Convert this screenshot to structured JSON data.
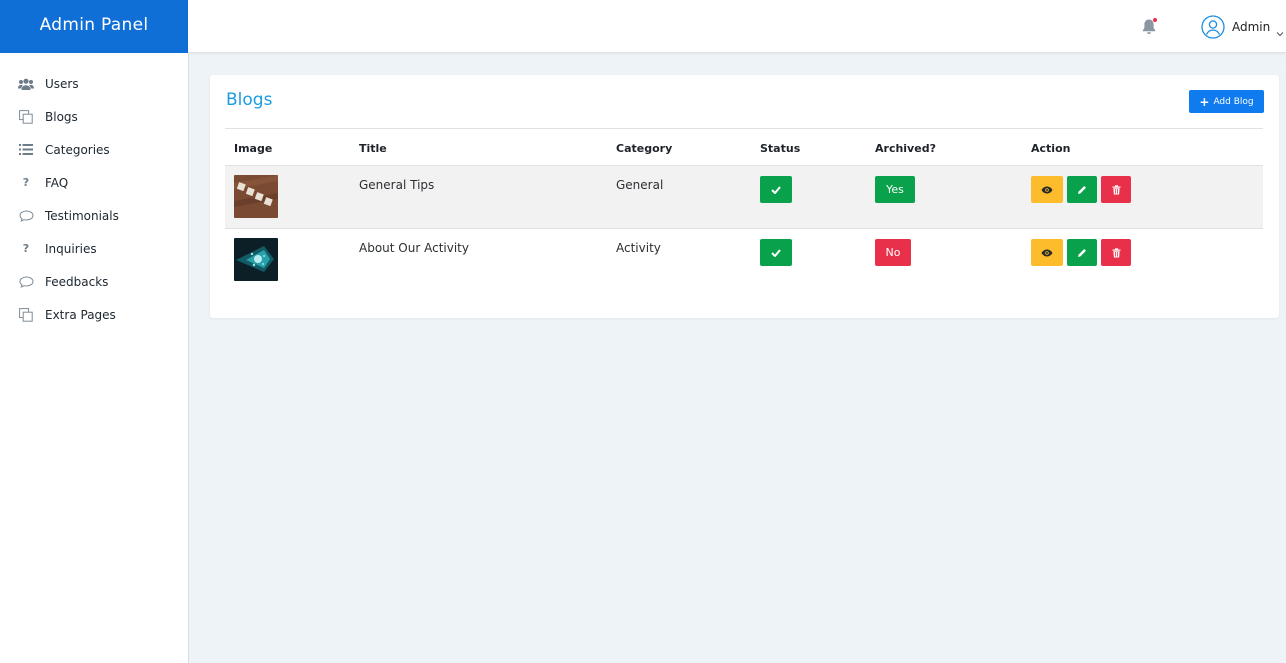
{
  "brand": {
    "title": "Admin Panel"
  },
  "topbar": {
    "bell_icon": "bell-icon",
    "user_name": "Admin",
    "avatar_icon": "user-circle-icon"
  },
  "sidebar": {
    "items": [
      {
        "label": "Users",
        "icon": "users-icon"
      },
      {
        "label": "Blogs",
        "icon": "copy-icon"
      },
      {
        "label": "Categories",
        "icon": "list-icon"
      },
      {
        "label": "FAQ",
        "icon": "question-icon"
      },
      {
        "label": "Testimonials",
        "icon": "comment-icon"
      },
      {
        "label": "Inquiries",
        "icon": "question-icon"
      },
      {
        "label": "Feedbacks",
        "icon": "comment-icon"
      },
      {
        "label": "Extra Pages",
        "icon": "copy-icon"
      }
    ]
  },
  "main": {
    "title": "Blogs",
    "add_button": "Add Blog",
    "table": {
      "headers": [
        "Image",
        "Title",
        "Category",
        "Status",
        "Archived?",
        "Action"
      ],
      "rows": [
        {
          "title": "General Tips",
          "category": "General",
          "status": "active",
          "archived": "Yes"
        },
        {
          "title": "About Our Activity",
          "category": "Activity",
          "status": "active",
          "archived": "No"
        }
      ]
    }
  },
  "colors": {
    "brand": "#0f6fd6",
    "title": "#1b9de0",
    "success": "#0aa14c",
    "danger": "#e8304a",
    "warning": "#fdbc2c",
    "primary": "#0f7bef"
  }
}
